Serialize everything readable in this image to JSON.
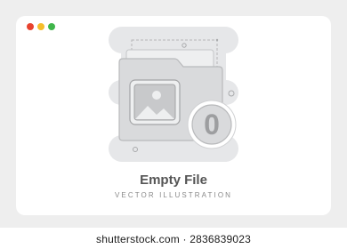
{
  "window": {
    "controls": [
      {
        "name": "close",
        "color": "#e8432f"
      },
      {
        "name": "minimize",
        "color": "#f5bd2a"
      },
      {
        "name": "maximize",
        "color": "#3fb54a"
      }
    ]
  },
  "illustration": {
    "icon": "empty-folder-icon",
    "badge_count": "0",
    "image_icon": "image-icon"
  },
  "content": {
    "title": "Empty File",
    "subtitle": "VECTOR ILLUSTRATION"
  },
  "watermark": {
    "text": "shutterstock.com · 2836839023"
  },
  "colors": {
    "background": "#eeeeee",
    "card": "#ffffff",
    "shape_light": "#e6e7e9",
    "folder": "#d9dadc",
    "folder_stroke": "#b9babc",
    "text_dark": "#555555"
  }
}
